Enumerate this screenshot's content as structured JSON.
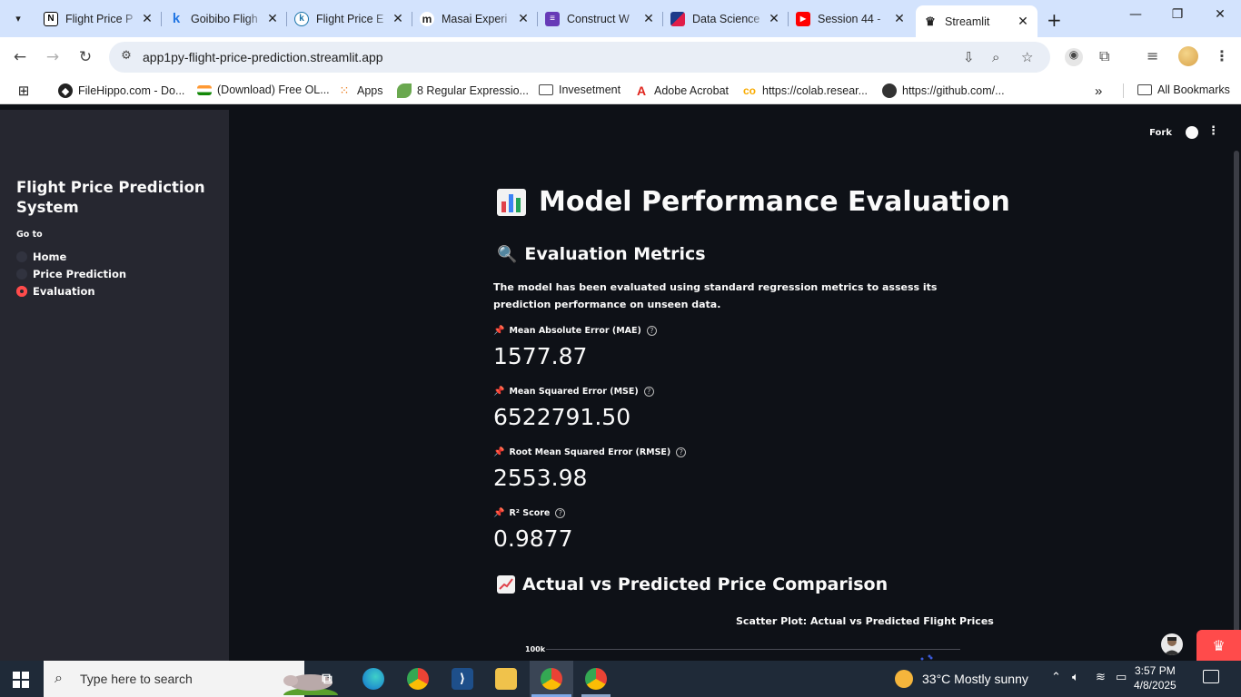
{
  "browser": {
    "tabs": [
      {
        "title": "Flight Price P",
        "favicon": "notion-icon",
        "color": "#000000",
        "glyph": "N"
      },
      {
        "title": "Goibibo Fligh",
        "favicon": "goibibo-icon",
        "color": "#2276e3",
        "glyph": "k"
      },
      {
        "title": "Flight Price E",
        "favicon": "kaggle-icon",
        "color": "#1a73a8",
        "glyph": "k"
      },
      {
        "title": "Masai Experi",
        "favicon": "masai-icon",
        "color": "#2b2b2b",
        "glyph": "m"
      },
      {
        "title": "Construct W",
        "favicon": "forms-icon",
        "color": "#673ab7",
        "glyph": "≡"
      },
      {
        "title": "Data Science",
        "favicon": "datascience-icon",
        "color": "#1e3a8a",
        "glyph": "D"
      },
      {
        "title": "Session 44 -",
        "favicon": "youtube-icon",
        "color": "#ff0000",
        "glyph": "▶"
      },
      {
        "title": "Streamlit",
        "favicon": "streamlit-icon",
        "color": "#333333",
        "glyph": "◣"
      }
    ],
    "url": "app1py-flight-price-prediction.streamlit.app",
    "bookmarks": [
      {
        "label": "FileHippo.com - Do...",
        "icon": "filehippo-icon"
      },
      {
        "label": "(Download) Free OL...",
        "icon": "india-flag-icon"
      },
      {
        "label": "Apps",
        "icon": "apps-grid-icon"
      },
      {
        "label": "8 Regular Expressio...",
        "icon": "leaf-icon"
      },
      {
        "label": "Invesetment",
        "icon": "folder-icon"
      },
      {
        "label": "Adobe Acrobat",
        "icon": "acrobat-icon"
      },
      {
        "label": "https://colab.resear...",
        "icon": "colab-icon"
      },
      {
        "label": "https://github.com/...",
        "icon": "github-icon"
      }
    ],
    "more_bookmarks": "»",
    "all_bookmarks": "All Bookmarks"
  },
  "sidebar": {
    "title": "Flight Price Prediction System",
    "goto_label": "Go to",
    "options": [
      {
        "label": "Home",
        "selected": false
      },
      {
        "label": "Price Prediction",
        "selected": false
      },
      {
        "label": "Evaluation",
        "selected": true
      }
    ]
  },
  "header": {
    "fork": "Fork"
  },
  "main": {
    "title": "Model Performance Evaluation",
    "metrics_heading": "Evaluation Metrics",
    "description": "The model has been evaluated using standard regression metrics to assess its prediction performance on unseen data.",
    "metrics": [
      {
        "label": "Mean Absolute Error (MAE)",
        "value": "1577.87"
      },
      {
        "label": "Mean Squared Error (MSE)",
        "value": "6522791.50"
      },
      {
        "label": "Root Mean Squared Error (RMSE)",
        "value": "2553.98"
      },
      {
        "label": "R² Score",
        "value": "0.9877"
      }
    ],
    "comparison_heading": "Actual vs Predicted Price Comparison",
    "plot_title": "Scatter Plot: Actual vs Predicted Flight Prices",
    "plot_tick": "100k"
  },
  "taskbar": {
    "search_placeholder": "Type here to search",
    "weather": "33°C  Mostly sunny",
    "time": "3:57 PM",
    "date": "4/8/2025"
  },
  "colors": {
    "accent": "#ff4b4b",
    "sidebar": "#262730",
    "background": "#0e1117"
  }
}
